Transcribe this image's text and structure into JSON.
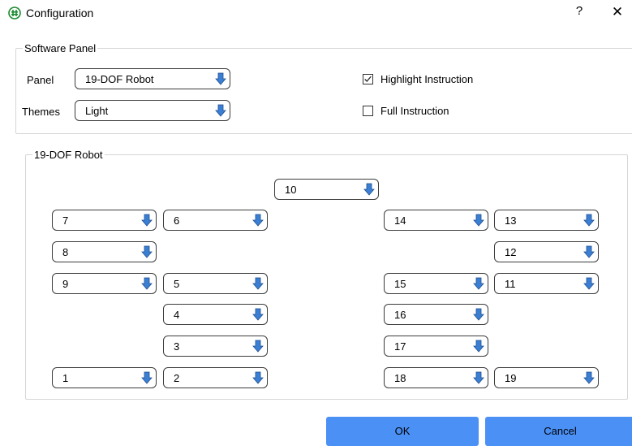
{
  "window": {
    "title": "Configuration",
    "help_label": "?",
    "close_label": "✕",
    "icon": "app-logo-icon"
  },
  "software_panel": {
    "legend": "Software Panel",
    "panel_label": "Panel",
    "panel_value": "19-DOF Robot",
    "themes_label": "Themes",
    "themes_value": "Light",
    "highlight_instruction": {
      "label": "Highlight Instruction",
      "checked": true
    },
    "full_instruction": {
      "label": "Full Instruction",
      "checked": false
    }
  },
  "robot_panel": {
    "legend": "19-DOF Robot",
    "joints": {
      "j1": "1",
      "j2": "2",
      "j3": "3",
      "j4": "4",
      "j5": "5",
      "j6": "6",
      "j7": "7",
      "j8": "8",
      "j9": "9",
      "j10": "10",
      "j11": "11",
      "j12": "12",
      "j13": "13",
      "j14": "14",
      "j15": "15",
      "j16": "16",
      "j17": "17",
      "j18": "18",
      "j19": "19"
    }
  },
  "buttons": {
    "ok": "OK",
    "cancel": "Cancel"
  },
  "colors": {
    "arrow": "#3b7fd4",
    "button": "#4a90f5",
    "border": "#d6d6d6"
  }
}
